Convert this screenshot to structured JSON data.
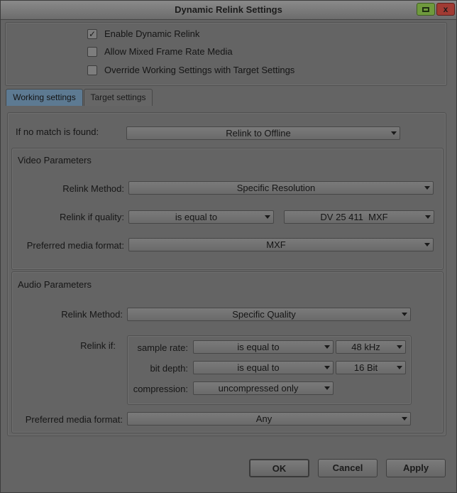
{
  "window": {
    "title": "Dynamic Relink Settings",
    "maximize_icon": "maximize-icon",
    "close_label": "x"
  },
  "options": [
    {
      "label": "Enable Dynamic Relink",
      "checked": true
    },
    {
      "label": "Allow Mixed Frame Rate Media",
      "checked": false
    },
    {
      "label": "Override Working Settings with Target Settings",
      "checked": false
    }
  ],
  "check_mark": "✓",
  "tabs": [
    {
      "label": "Working settings",
      "active": true
    },
    {
      "label": "Target settings",
      "active": false
    }
  ],
  "no_match": {
    "label": "If no match is found:",
    "value": "Relink to Offline"
  },
  "video": {
    "title": "Video Parameters",
    "relink_method_label": "Relink Method:",
    "relink_method_value": "Specific Resolution",
    "quality_label": "Relink if quality:",
    "quality_op": "is equal to",
    "quality_value": "DV 25 411  MXF",
    "format_label": "Preferred media format:",
    "format_value": "MXF"
  },
  "audio": {
    "title": "Audio Parameters",
    "relink_method_label": "Relink Method:",
    "relink_method_value": "Specific Quality",
    "relink_if_label": "Relink if:",
    "sample_rate_label": "sample rate:",
    "sample_rate_op": "is equal to",
    "sample_rate_value": "48 kHz",
    "bit_depth_label": "bit depth:",
    "bit_depth_op": "is equal to",
    "bit_depth_value": "16 Bit",
    "compression_label": "compression:",
    "compression_value": "uncompressed only",
    "format_label": "Preferred media format:",
    "format_value": "Any"
  },
  "buttons": {
    "ok": "OK",
    "cancel": "Cancel",
    "apply": "Apply"
  }
}
